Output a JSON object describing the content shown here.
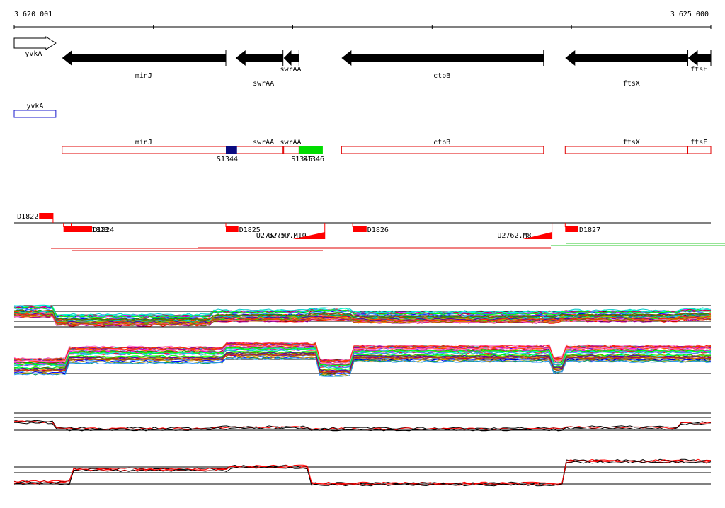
{
  "ruler": {
    "start_label": "3 620 001",
    "end_label": "3 625 000",
    "start": 3620001,
    "end": 3625000
  },
  "colors": {
    "gene_fill": "#000000",
    "outline_blue": "#1a1acc",
    "outline_red": "#e00000",
    "navy": "#0a0a80",
    "green": "#00dd00",
    "red": "#ff0000"
  },
  "genes": [
    {
      "name": "yvkA",
      "start": 3620001,
      "end": 3620300,
      "strand": "+",
      "label_pos": 3620140
    },
    {
      "name": "minJ",
      "start": 3620345,
      "end": 3621520,
      "strand": "-",
      "label_pos": 3620930
    },
    {
      "name": "swrAA",
      "start": 3621590,
      "end": 3621930,
      "strand": "-",
      "label_pos": 3621790
    },
    {
      "name": "swrAA",
      "start": 3621935,
      "end": 3622045,
      "strand": "-",
      "label_pos": 3621985
    },
    {
      "name": "ctpB",
      "start": 3622350,
      "end": 3623800,
      "strand": "-",
      "label_pos": 3623070
    },
    {
      "name": "ftsX",
      "start": 3623955,
      "end": 3624835,
      "strand": "-",
      "label_pos": 3624430
    },
    {
      "name": "ftsE",
      "start": 3624835,
      "end": 3625000,
      "strand": "-",
      "label_pos": 3624915
    }
  ],
  "features_blue": [
    {
      "name": "yvkA",
      "start": 3620001,
      "end": 3620300
    }
  ],
  "features_red": [
    {
      "name": "minJ",
      "start": 3620345,
      "end": 3621930,
      "label_pos": 3620930
    },
    {
      "name": "swrAA",
      "start": 3621590,
      "end": 3621930,
      "label_pos": 3621790
    },
    {
      "name": "swrAA",
      "start": 3621935,
      "end": 3622045,
      "label_pos": 3621985
    },
    {
      "name": "ctpB",
      "start": 3622350,
      "end": 3623800,
      "label_pos": 3623070
    },
    {
      "name": "ftsX",
      "start": 3623955,
      "end": 3624835,
      "label_pos": 3624430
    },
    {
      "name": "ftsE",
      "start": 3624835,
      "end": 3625000,
      "label_pos": 3624915
    }
  ],
  "sites": [
    {
      "name": "S1344",
      "start": 3621520,
      "end": 3621600,
      "color": "navy"
    },
    {
      "name": "S1345",
      "start": 3622045,
      "end": 3622215,
      "color": "green"
    },
    {
      "name": "S1346",
      "start": 3622045,
      "end": 3622215,
      "color": "green"
    }
  ],
  "segments_top": [
    {
      "name": "D1822",
      "start": 3620180,
      "end": 3620280
    }
  ],
  "segments_bottom": [
    {
      "name": "D1823",
      "start": 3620355,
      "end": 3620520
    },
    {
      "name": "D1824",
      "start": 3620410,
      "end": 3620560
    },
    {
      "name": "D1825",
      "start": 3621520,
      "end": 3621610
    },
    {
      "name": "D1826",
      "start": 3622430,
      "end": 3622530
    },
    {
      "name": "D1827",
      "start": 3623955,
      "end": 3624050
    }
  ],
  "upstream_labels": [
    {
      "name": "U2757.M7",
      "pos": 3621860
    },
    {
      "name": "U2757.M10",
      "pos": 3621960
    },
    {
      "name": "U2762.M8",
      "pos": 3623590
    }
  ]
}
